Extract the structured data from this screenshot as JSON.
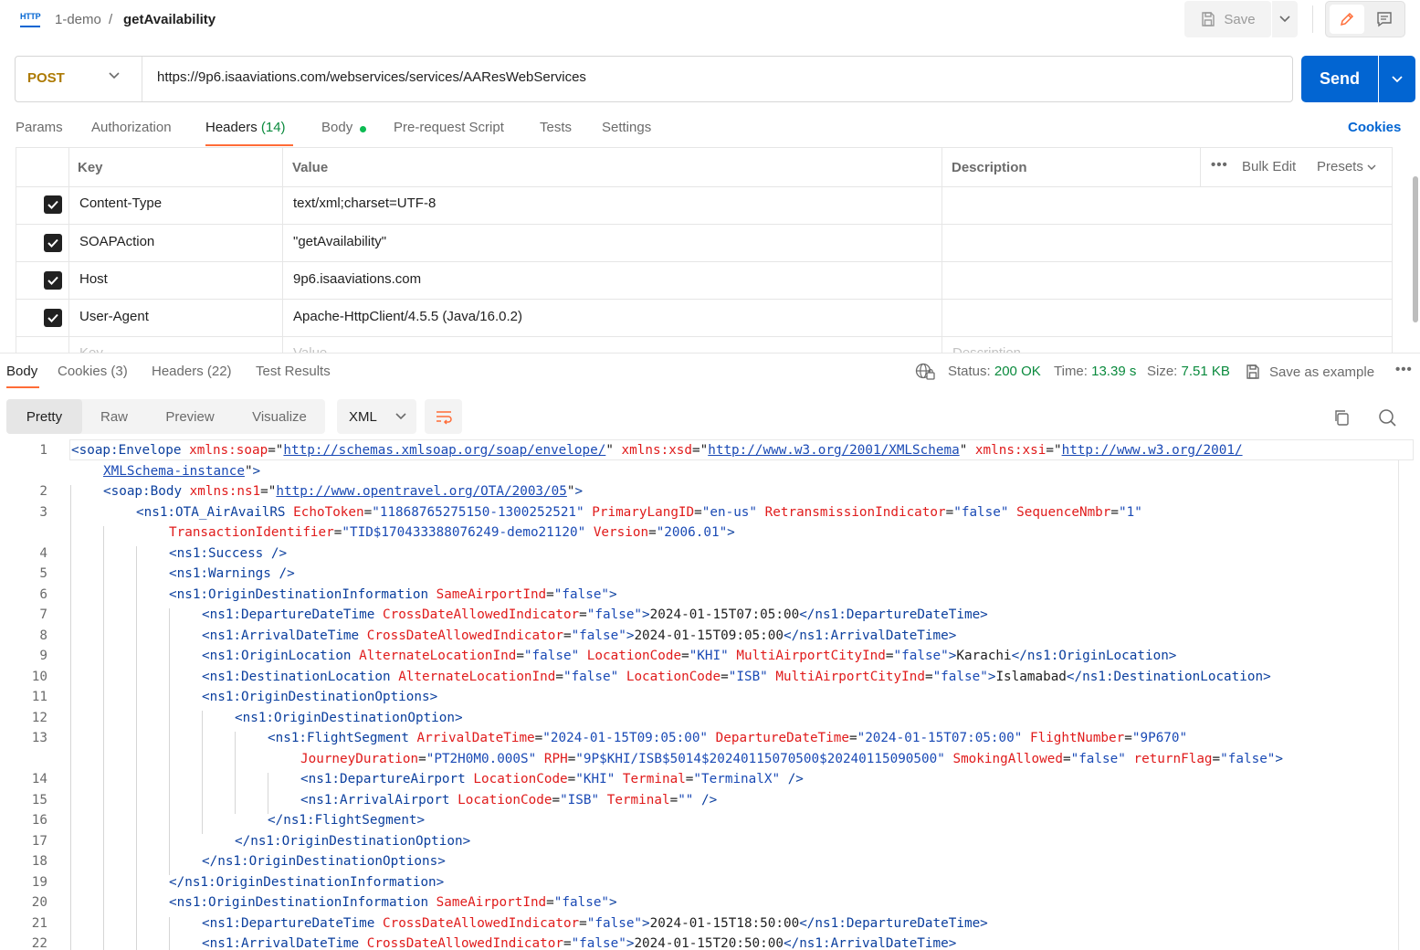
{
  "header": {
    "http_badge": "HTTP",
    "collection": "1-demo",
    "separator": "/",
    "request_name": "getAvailability",
    "save_label": "Save"
  },
  "request": {
    "method": "POST",
    "url": "https://9p6.isaaviations.com/webservices/services/AAResWebServices",
    "send_label": "Send"
  },
  "request_tabs": {
    "params": "Params",
    "authorization": "Authorization",
    "headers": "Headers",
    "headers_count": "(14)",
    "body": "Body",
    "pre_request": "Pre-request Script",
    "tests": "Tests",
    "settings": "Settings",
    "cookies": "Cookies"
  },
  "headers_table": {
    "col_key": "Key",
    "col_value": "Value",
    "col_description": "Description",
    "bulk_edit": "Bulk Edit",
    "presets": "Presets",
    "rows": [
      {
        "key": "Content-Type",
        "value": "text/xml;charset=UTF-8"
      },
      {
        "key": "SOAPAction",
        "value": "\"getAvailability\""
      },
      {
        "key": "Host",
        "value": "9p6.isaaviations.com"
      },
      {
        "key": "User-Agent",
        "value": "Apache-HttpClient/4.5.5 (Java/16.0.2)"
      }
    ],
    "placeholder_key": "Key",
    "placeholder_value": "Value",
    "placeholder_description": "Description"
  },
  "response_tabs": {
    "body": "Body",
    "cookies": "Cookies (3)",
    "headers": "Headers (22)",
    "test_results": "Test Results"
  },
  "response_meta": {
    "status_label": "Status:",
    "status_value": "200 OK",
    "time_label": "Time:",
    "time_value": "13.39 s",
    "size_label": "Size:",
    "size_value": "7.51 KB",
    "save_example": "Save as example"
  },
  "view_modes": {
    "pretty": "Pretty",
    "raw": "Raw",
    "preview": "Preview",
    "visualize": "Visualize",
    "format": "XML"
  },
  "code": {
    "line_numbers": [
      "1",
      "2",
      "3",
      "4",
      "5",
      "6",
      "7",
      "8",
      "9",
      "10",
      "11",
      "12",
      "13",
      "14",
      "15",
      "16",
      "17",
      "18",
      "19",
      "20",
      "21",
      "22"
    ],
    "l1_tag": "<soap:Envelope",
    "l1_a1": " xmlns:soap",
    "l1_v1": "http://schemas.xmlsoap.org/soap/envelope/",
    "l1_a2": " xmlns:xsd",
    "l1_v2": "http://www.w3.org/2001/XMLSchema",
    "l1_a3": " xmlns:xsi",
    "l1_v3a": "http://www.w3.org/2001/",
    "l1_v3b": "XMLSchema-instance",
    "l2_tag": "<soap:Body",
    "l2_a1": " xmlns:ns1",
    "l2_v1": "http://www.opentravel.org/OTA/2003/05",
    "l3_tag": "<ns1:OTA_AirAvailRS",
    "l3_a1": " EchoToken",
    "l3_v1": "\"11868765275150-1300252521\"",
    "l3_a2": " PrimaryLangID",
    "l3_v2": "\"en-us\"",
    "l3_a3": " RetransmissionIndicator",
    "l3_v3": "\"false\"",
    "l3_a4": " SequenceNmbr",
    "l3_v4": "\"1\"",
    "l3_a5": "TransactionIdentifier",
    "l3_v5": "\"TID$170433388076249-demo21120\"",
    "l3_a6": " Version",
    "l3_v6": "\"2006.01\"",
    "l4": "<ns1:Success />",
    "l5": "<ns1:Warnings />",
    "l6_tag": "<ns1:OriginDestinationInformation",
    "l6_a1": " SameAirportInd",
    "l6_v1": "\"false\"",
    "l7_tag": "<ns1:DepartureDateTime",
    "l7_a1": " CrossDateAllowedIndicator",
    "l7_v1": "\"false\"",
    "l7_text": "2024-01-15T07:05:00",
    "l7_close": "</ns1:DepartureDateTime>",
    "l8_tag": "<ns1:ArrivalDateTime",
    "l8_a1": " CrossDateAllowedIndicator",
    "l8_v1": "\"false\"",
    "l8_text": "2024-01-15T09:05:00",
    "l8_close": "</ns1:ArrivalDateTime>",
    "l9_tag": "<ns1:OriginLocation",
    "l9_a1": " AlternateLocationInd",
    "l9_v1": "\"false\"",
    "l9_a2": " LocationCode",
    "l9_v2": "\"KHI\"",
    "l9_a3": " MultiAirportCityInd",
    "l9_v3": "\"false\"",
    "l9_text": "Karachi",
    "l9_close": "</ns1:OriginLocation>",
    "l10_tag": "<ns1:DestinationLocation",
    "l10_a1": " AlternateLocationInd",
    "l10_v1": "\"false\"",
    "l10_a2": " LocationCode",
    "l10_v2": "\"ISB\"",
    "l10_a3": " MultiAirportCityInd",
    "l10_v3": "\"false\"",
    "l10_text": "Islamabad",
    "l10_close": "</ns1:DestinationLocation>",
    "l11": "<ns1:OriginDestinationOptions>",
    "l12": "<ns1:OriginDestinationOption>",
    "l13_tag": "<ns1:FlightSegment",
    "l13_a1": " ArrivalDateTime",
    "l13_v1": "\"2024-01-15T09:05:00\"",
    "l13_a2": " DepartureDateTime",
    "l13_v2": "\"2024-01-15T07:05:00\"",
    "l13_a3": " FlightNumber",
    "l13_v3": "\"9P670\"",
    "l13_a4": "JourneyDuration",
    "l13_v4": "\"PT2H0M0.000S\"",
    "l13_a5": " RPH",
    "l13_v5": "\"9P$KHI/ISB$5014$20240115070500$20240115090500\"",
    "l13_a6": " SmokingAllowed",
    "l13_v6": "\"false\"",
    "l13_a7": " returnFlag",
    "l13_v7": "\"false\"",
    "l14_tag": "<ns1:DepartureAirport",
    "l14_a1": " LocationCode",
    "l14_v1": "\"KHI\"",
    "l14_a2": " Terminal",
    "l14_v2": "\"TerminalX\"",
    "l15_tag": "<ns1:ArrivalAirport",
    "l15_a1": " LocationCode",
    "l15_v1": "\"ISB\"",
    "l15_a2": " Terminal",
    "l15_v2": "\"\"",
    "l16": "</ns1:FlightSegment>",
    "l17": "</ns1:OriginDestinationOption>",
    "l18": "</ns1:OriginDestinationOptions>",
    "l19": "</ns1:OriginDestinationInformation>",
    "l20_tag": "<ns1:OriginDestinationInformation",
    "l20_a1": " SameAirportInd",
    "l20_v1": "\"false\"",
    "l21_tag": "<ns1:DepartureDateTime",
    "l21_a1": " CrossDateAllowedIndicator",
    "l21_v1": "\"false\"",
    "l21_text": "2024-01-15T18:50:00",
    "l21_close": "</ns1:DepartureDateTime>",
    "l22_tag": "<ns1:ArrivalDateTime",
    "l22_a1": " CrossDateAllowedIndicator",
    "l22_v1": "\"false\"",
    "l22_text": "2024-01-15T20:50:00",
    "l22_close": "</ns1:ArrivalDateTime>"
  },
  "colors": {
    "accent": "#ff6c37",
    "send": "#0265d2",
    "method_post": "#ad7a03",
    "status_ok": "#0a8a3d",
    "xml_tag": "#0b3f9e",
    "xml_attr": "#e01b1b",
    "xml_value": "#1a4ab5"
  }
}
